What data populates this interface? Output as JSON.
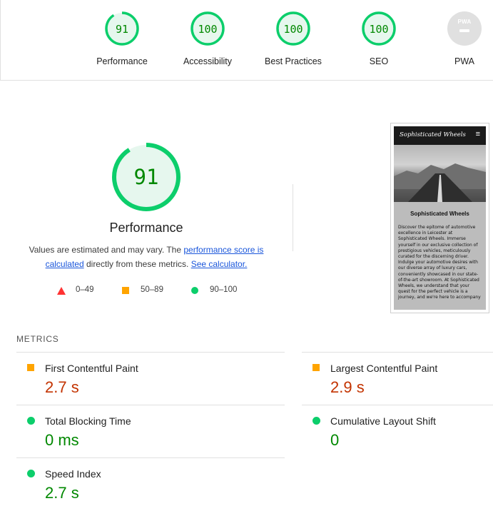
{
  "top_scores": [
    {
      "label": "Performance",
      "score": "91",
      "color": "#0cce6b"
    },
    {
      "label": "Accessibility",
      "score": "100",
      "color": "#0cce6b"
    },
    {
      "label": "Best Practices",
      "score": "100",
      "color": "#0cce6b"
    },
    {
      "label": "SEO",
      "score": "100",
      "color": "#0cce6b"
    },
    {
      "label": "PWA",
      "badge_text": "PWA"
    }
  ],
  "main": {
    "score": "91",
    "score_fraction": 0.91,
    "title": "Performance",
    "desc_prefix": "Values are estimated and may vary. The ",
    "desc_link1": "performance score is calculated",
    "desc_middle": " directly from these metrics. ",
    "desc_link2": "See calculator."
  },
  "legend": [
    {
      "range": "0–49",
      "shape": "triangle",
      "color": "#ff3333"
    },
    {
      "range": "50–89",
      "shape": "square",
      "color": "#ffa400"
    },
    {
      "range": "90–100",
      "shape": "circle",
      "color": "#0cce6b"
    }
  ],
  "screenshot": {
    "brand": "Sophisticated Wheels",
    "menu_icon": "hamburger-icon",
    "heading": "Sophisticated Wheels",
    "body": "Discover the epitome of automotive excellence in Leicester at Sophisticated Wheels. Immerse yourself in our exclusive collection of prestigious vehicles, meticulously curated for the discerning driver. Indulge your automotive desires with our diverse array of luxury cars, conveniently showcased in our state-of-the-art showroom. At Sophisticated Wheels, we understand that your quest for the perfect vehicle is a journey, and we're here to accompany"
  },
  "metrics_heading": "METRICS",
  "metrics": [
    {
      "name": "First Contentful Paint",
      "value": "2.7 s",
      "status": "average"
    },
    {
      "name": "Largest Contentful Paint",
      "value": "2.9 s",
      "status": "average"
    },
    {
      "name": "Total Blocking Time",
      "value": "0 ms",
      "status": "pass"
    },
    {
      "name": "Cumulative Layout Shift",
      "value": "0",
      "status": "pass"
    },
    {
      "name": "Speed Index",
      "value": "2.7 s",
      "status": "pass"
    }
  ],
  "colors": {
    "pass": "#0cce6b",
    "pass_text": "#008800",
    "average": "#ffa400",
    "average_text": "#c33300",
    "fail": "#ff3333"
  }
}
